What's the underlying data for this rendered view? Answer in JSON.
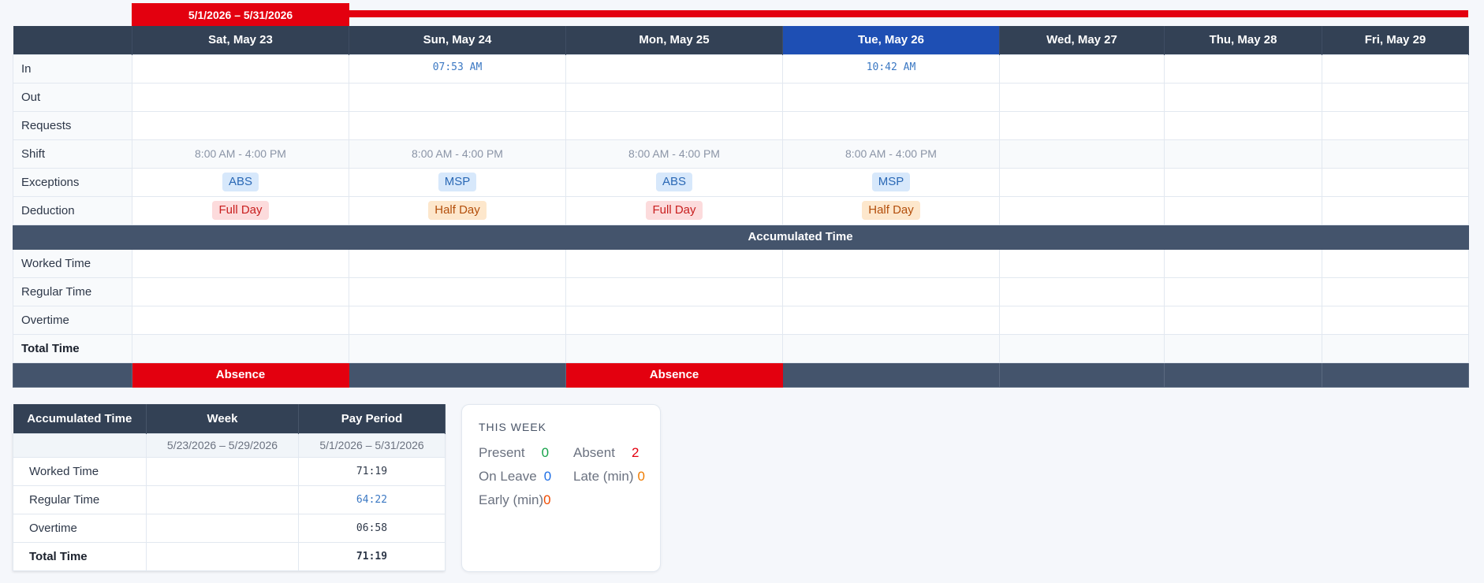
{
  "period": {
    "label": "5/1/2026 – 5/31/2026"
  },
  "days": [
    {
      "label": "Sat, May 23",
      "in": "",
      "shift": "8:00 AM - 4:00 PM",
      "exception": "ABS",
      "deduction": "Full Day",
      "footer": "Absence"
    },
    {
      "label": "Sun, May 24",
      "in": "07:53 AM",
      "shift": "8:00 AM - 4:00 PM",
      "exception": "MSP",
      "deduction": "Half Day",
      "footer": ""
    },
    {
      "label": "Mon, May 25",
      "in": "",
      "shift": "8:00 AM - 4:00 PM",
      "exception": "ABS",
      "deduction": "Full Day",
      "footer": "Absence"
    },
    {
      "label": "Tue, May 26",
      "in": "10:42 AM",
      "shift": "8:00 AM - 4:00 PM",
      "exception": "MSP",
      "deduction": "Half Day",
      "footer": ""
    },
    {
      "label": "Wed, May 27",
      "in": "",
      "shift": "",
      "exception": "",
      "deduction": "",
      "footer": ""
    },
    {
      "label": "Thu, May 28",
      "in": "",
      "shift": "",
      "exception": "",
      "deduction": "",
      "footer": ""
    },
    {
      "label": "Fri, May 29",
      "in": "",
      "shift": "",
      "exception": "",
      "deduction": "",
      "footer": ""
    }
  ],
  "row_labels": {
    "in": "In",
    "out": "Out",
    "requests": "Requests",
    "shift": "Shift",
    "exceptions": "Exceptions",
    "deduction": "Deduction",
    "worked": "Worked Time",
    "regular": "Regular Time",
    "overtime": "Overtime",
    "total": "Total Time"
  },
  "section_title": "Accumulated Time",
  "summary": {
    "headers": [
      "Accumulated Time",
      "Week",
      "Pay Period"
    ],
    "week_range": "5/23/2026 – 5/29/2026",
    "pay_range": "5/1/2026 – 5/31/2026",
    "rows": [
      {
        "label": "Worked Time",
        "week": "",
        "pay": "71:19"
      },
      {
        "label": "Regular Time",
        "week": "",
        "pay": "64:22"
      },
      {
        "label": "Overtime",
        "week": "",
        "pay": "06:58"
      },
      {
        "label": "Total Time",
        "week": "",
        "pay": "71:19"
      }
    ]
  },
  "this_week": {
    "title": "THIS WEEK",
    "present_label": "Present",
    "present_value": "0",
    "absent_label": "Absent",
    "absent_value": "2",
    "leave_label": "On Leave",
    "leave_value": "0",
    "late_label": "Late (min)",
    "late_value": "0",
    "early_label": "Early (min)",
    "early_value": "0"
  },
  "colors": {
    "accent_red": "#e3000f",
    "header_dark": "#334155",
    "today_blue": "#1e4fb4"
  }
}
